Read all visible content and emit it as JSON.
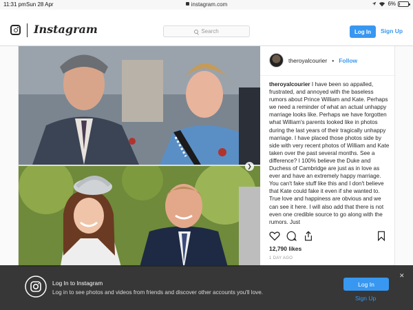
{
  "status_bar": {
    "time": "11:31 pm",
    "date": "Sun 28 Apr",
    "url": "instagram.com",
    "battery": "6%",
    "battery_level": 0.06
  },
  "header": {
    "wordmark": "Instagram",
    "search_placeholder": "Search",
    "login_label": "Log In",
    "signup_label": "Sign Up",
    "accent": "#3897f0"
  },
  "post": {
    "author": "theroyalcourier",
    "separator": "•",
    "follow_label": "Follow",
    "caption_author": "theroyalcourier",
    "caption_text": "I have been so appalled, frustrated, and annoyed with the baseless rumors about Prince William and Kate. Perhaps we need a reminder of what an actual unhappy marriage looks like. Perhaps we have forgotten what William's parents looked like in photos during the last years of their tragically unhappy marriage. I have placed those photos side by side with very recent photos of William and Kate taken over the past several months. See a difference? I 100% believe the Duke and Duchess of Cambridge are just as in love as ever and have an extremely happy marriage. You can't fake stuff like this and I don't believe that Kate could fake it even if she wanted to. True love and happiness are obvious and we can see it here. I will also add that there is not even one credible source to go along with the rumors. Just",
    "likes": "12,790 likes",
    "time_ago": "1 DAY AGO"
  },
  "banner": {
    "title": "Log In to Instagram",
    "subtitle": "Log in to see photos and videos from friends and discover other accounts you'll love.",
    "login_label": "Log In",
    "signup_label": "Sign Up"
  },
  "icons": [
    "instagram-logo-icon",
    "search-icon",
    "next-arrow-icon",
    "heart-icon",
    "comment-icon",
    "share-icon",
    "bookmark-icon",
    "close-icon",
    "wifi-icon",
    "battery-icon",
    "lock-icon"
  ]
}
